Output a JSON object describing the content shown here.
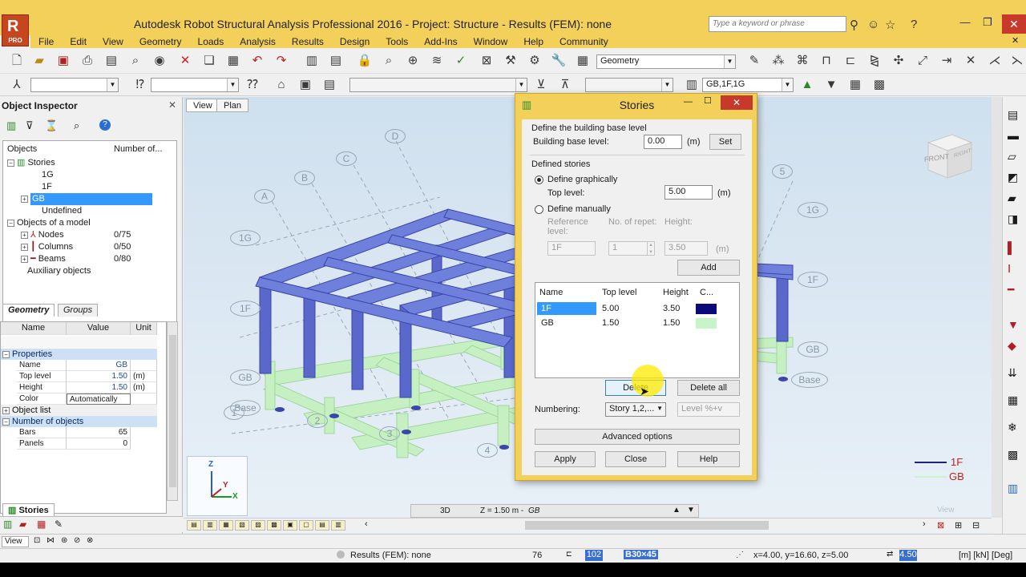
{
  "window": {
    "title": "Autodesk Robot Structural Analysis Professional 2016 - Project: Structure - Results (FEM): none",
    "logo_label": "PRO",
    "search_placeholder": "Type a keyword or phrase"
  },
  "menu": [
    "File",
    "Edit",
    "View",
    "Geometry",
    "Loads",
    "Analysis",
    "Results",
    "Design",
    "Tools",
    "Add-Ins",
    "Window",
    "Help",
    "Community"
  ],
  "toolbar": {
    "layout_combo": "Geometry",
    "story_combo": "GB,1F,1G"
  },
  "inspector": {
    "title": "Object Inspector",
    "col_objects": "Objects",
    "col_number": "Number of...",
    "tree": [
      {
        "label": "Stories",
        "indent": 0,
        "count": ""
      },
      {
        "label": "1G",
        "indent": 2,
        "count": ""
      },
      {
        "label": "1F",
        "indent": 2,
        "count": ""
      },
      {
        "label": "GB",
        "indent": 1,
        "count": ""
      },
      {
        "label": "Undefined",
        "indent": 2,
        "count": ""
      },
      {
        "label": "Objects of a model",
        "indent": 0,
        "count": ""
      },
      {
        "label": "Nodes",
        "indent": 1,
        "count": "0/75"
      },
      {
        "label": "Columns",
        "indent": 1,
        "count": "0/50"
      },
      {
        "label": "Beams",
        "indent": 1,
        "count": "0/80"
      },
      {
        "label": "Auxiliary objects",
        "indent": 0,
        "count": ""
      }
    ],
    "tab_geometry": "Geometry",
    "tab_groups": "Groups",
    "props_header": {
      "name": "Name",
      "value": "Value",
      "unit": "Unit"
    },
    "sections": {
      "properties": "Properties",
      "object_list": "Object list",
      "number_of_objects": "Number of objects"
    },
    "properties": [
      {
        "name": "Name",
        "value": "GB",
        "unit": ""
      },
      {
        "name": "Top level",
        "value": "1.50",
        "unit": "(m)"
      },
      {
        "name": "Height",
        "value": "1.50",
        "unit": "(m)"
      },
      {
        "name": "Color",
        "value": "Automatically",
        "unit": ""
      }
    ],
    "counts": [
      {
        "name": "Bars",
        "value": "65"
      },
      {
        "name": "Panels",
        "value": "0"
      }
    ],
    "bottom_tab": "Stories"
  },
  "viewport": {
    "tab_view": "View",
    "tab_plan": "Plan",
    "grid_letters": [
      "A",
      "B",
      "C",
      "D"
    ],
    "grid_numbers": [
      "1",
      "2",
      "3",
      "4",
      "5"
    ],
    "level_labels": [
      "1G",
      "1F",
      "GB",
      "Base",
      "1G",
      "1F",
      "GB",
      "Base"
    ],
    "cube_front": "FRONT",
    "cube_right": "RIGHT",
    "mode_3d": "3D",
    "z_level": "Z = 1.50 m -",
    "z_story": "GB",
    "view_watermark": "View",
    "legend": [
      {
        "name": "1F",
        "color": "#1a237e"
      },
      {
        "name": "GB",
        "color": "#c8f5c8"
      }
    ],
    "axis_z": "Z",
    "axis_x": "X",
    "axis_y": "Y"
  },
  "dialog": {
    "title": "Stories",
    "base_section": "Define the building base level",
    "base_label": "Building base level:",
    "base_value": "0.00",
    "base_unit": "(m)",
    "set_button": "Set",
    "defined_section": "Defined stories",
    "radio_graphically": "Define graphically",
    "top_level_label": "Top level:",
    "top_level_value": "5.00",
    "top_level_unit": "(m)",
    "radio_manually": "Define manually",
    "ref_level_label": "Reference level:",
    "repet_label": "No. of repet:",
    "height_label": "Height:",
    "ref_value": "1F",
    "repet_value": "1",
    "height_value": "3.50",
    "height_unit": "(m)",
    "add_button": "Add",
    "list_headers": {
      "name": "Name",
      "top": "Top level",
      "height": "Height",
      "color": "C..."
    },
    "stories": [
      {
        "name": "1F",
        "top": "5.00",
        "height": "3.50",
        "color": "#0a0a78"
      },
      {
        "name": "GB",
        "top": "1.50",
        "height": "1.50",
        "color": "#c8f5c8"
      }
    ],
    "delete_button": "Delete",
    "delete_all_button": "Delete all",
    "numbering_label": "Numbering:",
    "numbering_value": "Story 1,2,...",
    "numbering_pattern": "Level %+v",
    "advanced_button": "Advanced options",
    "apply_button": "Apply",
    "close_button": "Close",
    "help_button": "Help"
  },
  "status": {
    "view_label": "View",
    "results": "Results (FEM): none",
    "node_count": "76",
    "section_num": "102",
    "section_name": "B30×45",
    "coords": "x=4.00, y=16.60, z=5.00",
    "value": "4.50",
    "units": "[m] [kN] [Deg]"
  }
}
